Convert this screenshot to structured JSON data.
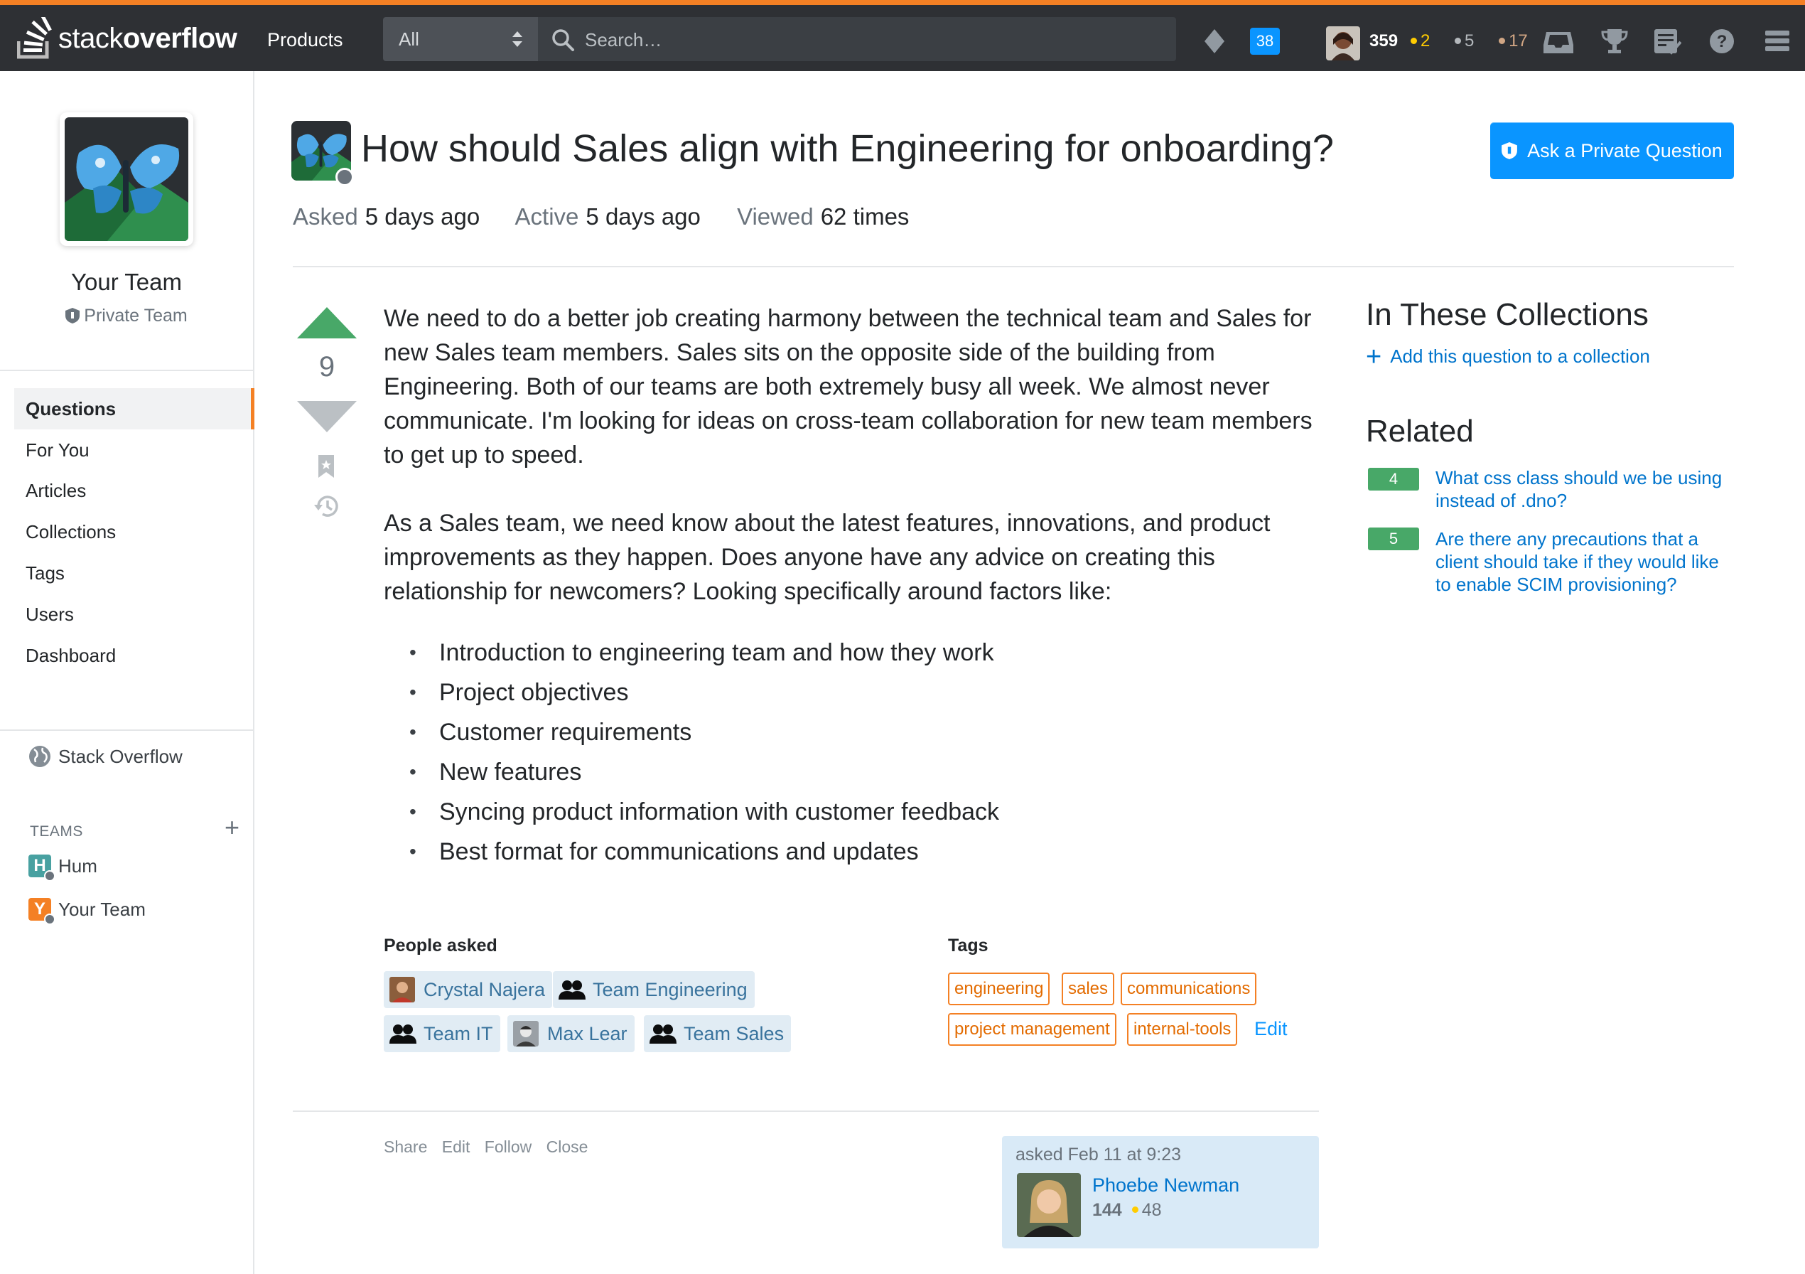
{
  "topbar": {
    "logo_text_light": "stack",
    "logo_text_bold": "overflow",
    "products": "Products",
    "scope": "All",
    "search_placeholder": "Search…",
    "inbox_count": "38",
    "reputation": "359",
    "gold": "2",
    "silver": "5",
    "bronze": "17"
  },
  "sidebar": {
    "team_name": "Your Team",
    "team_type": "Private Team",
    "nav": [
      "Questions",
      "For You",
      "Articles",
      "Collections",
      "Tags",
      "Users",
      "Dashboard"
    ],
    "stack_overflow": "Stack Overflow",
    "teams_label": "TEAMS",
    "teams": [
      {
        "initial": "H",
        "name": "Hum",
        "color": "#48a1a1"
      },
      {
        "initial": "Y",
        "name": "Your Team",
        "color": "#f48024"
      }
    ]
  },
  "question": {
    "title": "How should Sales align with Engineering for onboarding?",
    "ask_button": "Ask a Private Question",
    "asked_label": "Asked",
    "asked_value": "5 days ago",
    "active_label": "Active",
    "active_value": "5 days ago",
    "viewed_label": "Viewed",
    "viewed_value": "62 times",
    "votes": "9",
    "paragraphs": [
      "We need to do a better job creating harmony between the technical team and Sales for new Sales team members. Sales sits on the opposite side of the building from Engineering. Both of our teams are both extremely busy all week. We almost never communicate. I'm looking for ideas on cross-team collaboration for new team members to get up to speed.",
      "As a Sales team, we need know about the latest features, innovations, and product improvements as they happen. Does anyone have any advice on creating this relationship for newcomers? Looking specifically around factors like:"
    ],
    "bullets": [
      "Introduction to engineering team and how they work",
      "Project objectives",
      "Customer requirements",
      "New features",
      "Syncing product information with customer feedback",
      "Best format for communications and updates"
    ],
    "people_label": "People asked",
    "people": [
      "Crystal Najera",
      "Team Engineering",
      "Team IT",
      "Max Lear",
      "Team Sales"
    ],
    "tags_label": "Tags",
    "tags": [
      "engineering",
      "sales",
      "communications",
      "project management",
      "internal-tools"
    ],
    "tags_edit": "Edit",
    "menu": [
      "Share",
      "Edit",
      "Follow",
      "Close"
    ],
    "owner": {
      "asked": "asked Feb 11 at 9:23",
      "name": "Phoebe Newman",
      "rep": "144",
      "gold": "48"
    }
  },
  "right": {
    "collections_title": "In These Collections",
    "add_collection": "Add this question to a collection",
    "related_title": "Related",
    "related": [
      {
        "score": "4",
        "title": "What css class should we be using instead of .dno?"
      },
      {
        "score": "5",
        "title": "Are there any precautions that a client should take if they would like to enable SCIM provisioning?"
      }
    ]
  },
  "colors": {
    "accent": "#f48024",
    "link": "#0074cc",
    "primary_button": "#0a95ff",
    "vote_up": "#48a868",
    "gold": "#ffcc01",
    "silver": "#b4b8bc",
    "bronze": "#d1a684"
  },
  "icons": [
    "stackoverflow-logo-icon",
    "search-icon",
    "diamond-icon",
    "inbox-icon",
    "trophy-icon",
    "review-icon",
    "help-icon",
    "hamburger-icon",
    "shield-icon",
    "globe-icon",
    "plus-icon",
    "bookmark-icon",
    "history-icon",
    "group-icon"
  ]
}
